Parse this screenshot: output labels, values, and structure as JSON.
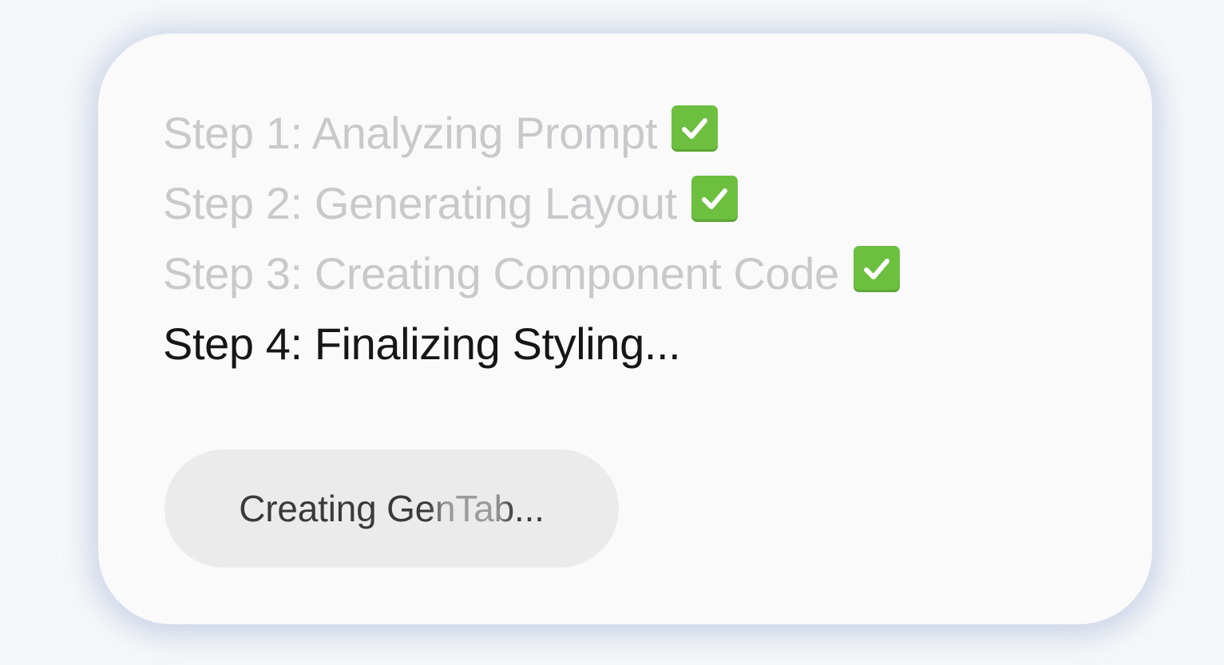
{
  "progress": {
    "steps": [
      {
        "label": "Step 1: Analyzing Prompt",
        "status": "done",
        "icon": "check-mark-button-icon"
      },
      {
        "label": "Step 2: Generating Layout",
        "status": "done",
        "icon": "check-mark-button-icon"
      },
      {
        "label": "Step 3: Creating Component Code",
        "status": "done",
        "icon": "check-mark-button-icon"
      },
      {
        "label": "Step 4: Finalizing Styling...",
        "status": "in-progress"
      }
    ]
  },
  "status_button": {
    "label": "Creating GenTab..."
  },
  "colors": {
    "done_text": "#c9c9cb",
    "active_text": "#161616",
    "check_green": "#6cbf3f",
    "pill_background": "#ebebeb"
  }
}
